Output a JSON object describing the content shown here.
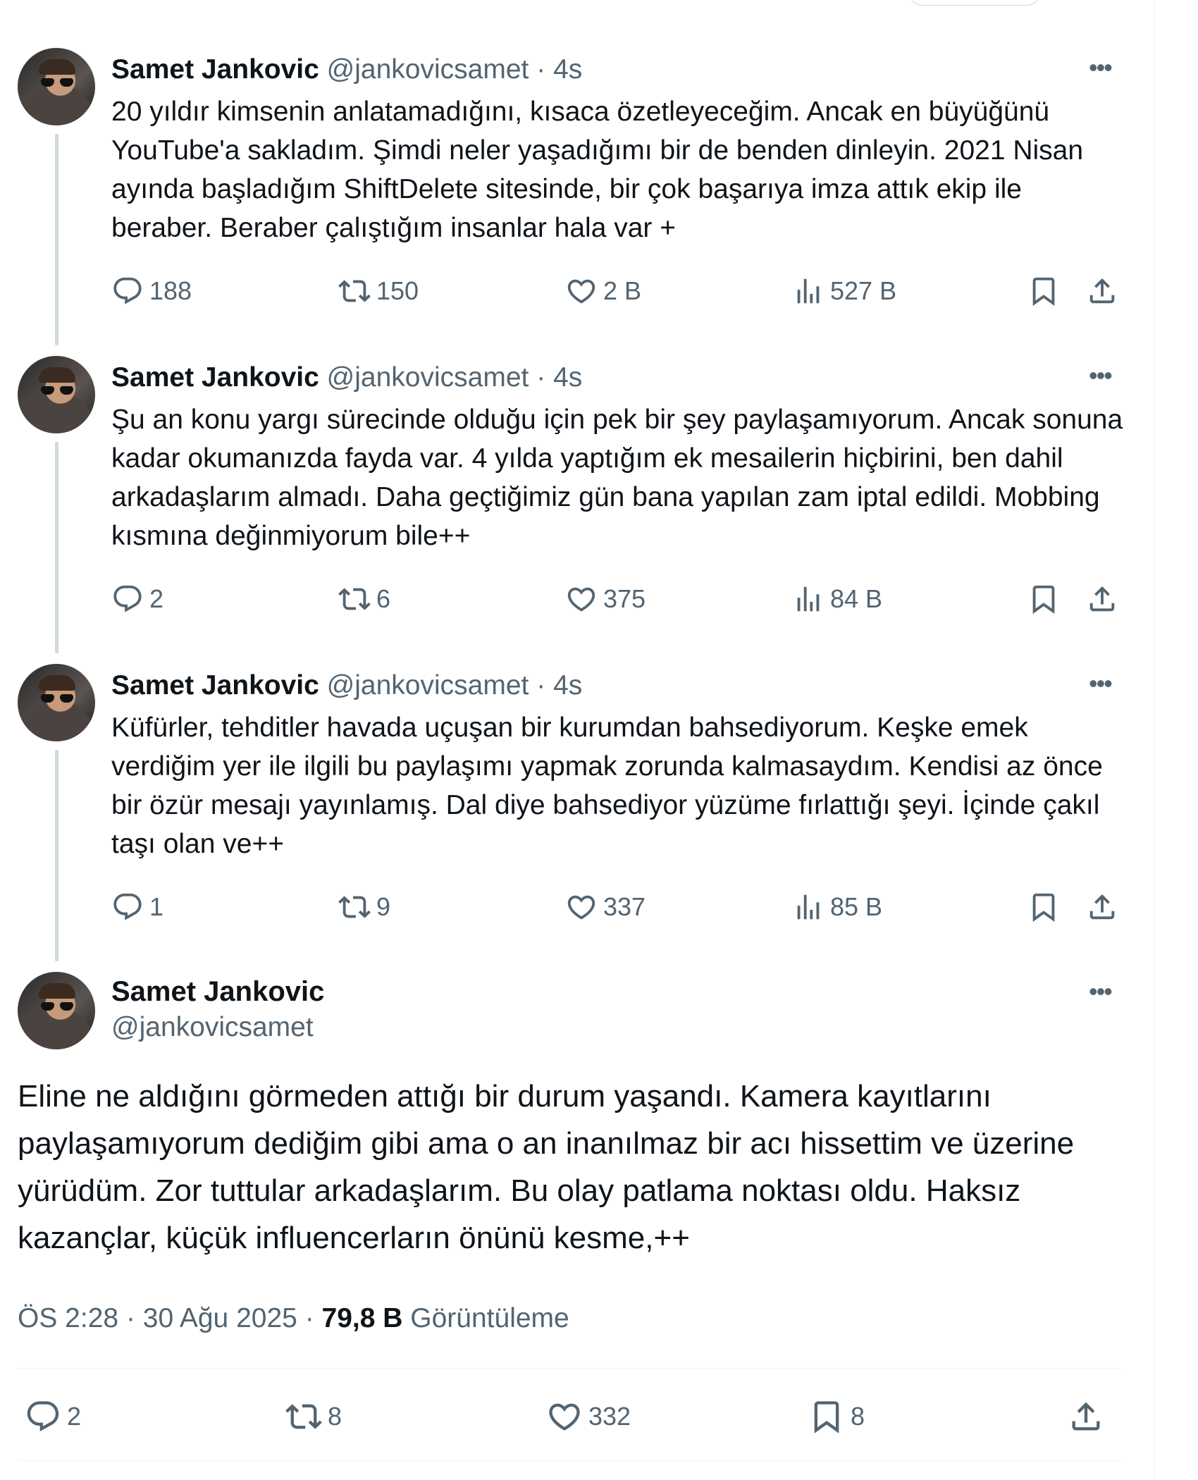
{
  "thread": [
    {
      "author": "Samet Jankovic",
      "handle": "@jankovicsamet",
      "sep": "·",
      "time": "4s",
      "text": "20 yıldır kimsenin anlatamadığını, kısaca özetleyeceğim. Ancak en büyüğünü YouTube'a sakladım. Şimdi neler yaşadığımı bir de benden dinleyin. 2021 Nisan ayında başladığım ShiftDelete sitesinde, bir çok başarıya imza attık ekip ile beraber. Beraber çalıştığım insanlar hala var +",
      "replies": "188",
      "reposts": "150",
      "likes": "2 B",
      "views": "527 B"
    },
    {
      "author": "Samet Jankovic",
      "handle": "@jankovicsamet",
      "sep": "·",
      "time": "4s",
      "text": "Şu an konu yargı sürecinde olduğu için pek bir şey paylaşamıyorum. Ancak sonuna kadar okumanızda fayda var. 4 yılda yaptığım ek mesailerin hiçbirini, ben dahil arkadaşlarım almadı. Daha geçtiğimiz gün bana yapılan zam iptal edildi. Mobbing kısmına değinmiyorum bile++",
      "replies": "2",
      "reposts": "6",
      "likes": "375",
      "views": "84 B"
    },
    {
      "author": "Samet Jankovic",
      "handle": "@jankovicsamet",
      "sep": "·",
      "time": "4s",
      "text": "Küfürler, tehditler havada uçuşan bir kurumdan bahsediyorum. Keşke emek verdiğim yer ile ilgili bu paylaşımı yapmak zorunda kalmasaydım. Kendisi az önce bir özür mesajı yayınlamış. Dal diye bahsediyor yüzüme fırlattığı şeyi. İçinde çakıl taşı olan ve++",
      "replies": "1",
      "reposts": "9",
      "likes": "337",
      "views": "85 B"
    }
  ],
  "main": {
    "author": "Samet Jankovic",
    "handle": "@jankovicsamet",
    "text": "Eline ne aldığını görmeden attığı bir durum yaşandı. Kamera kayıtlarını paylaşamıyorum dediğim gibi ama o an inanılmaz bir acı hissettim ve üzerine yürüdüm. Zor tuttular arkadaşlarım. Bu olay patlama noktası oldu. Haksız kazançlar, küçük influencerların önünü kesme,++",
    "time": "ÖS 2:28",
    "date": "30 Ağu 2025",
    "views_count": "79,8 B",
    "views_label": "Görüntüleme",
    "meta_sep": "·",
    "replies": "2",
    "reposts": "8",
    "likes": "332",
    "bookmarks": "8"
  },
  "icons": {
    "more": "more-icon",
    "reply": "reply-icon",
    "repost": "repost-icon",
    "like": "like-icon",
    "views": "views-icon",
    "bookmark": "bookmark-icon",
    "share": "share-icon"
  },
  "colors": {
    "text": "#0f1419",
    "secondary": "#536471",
    "line": "#cfd9de",
    "divider": "#eff3f4"
  }
}
